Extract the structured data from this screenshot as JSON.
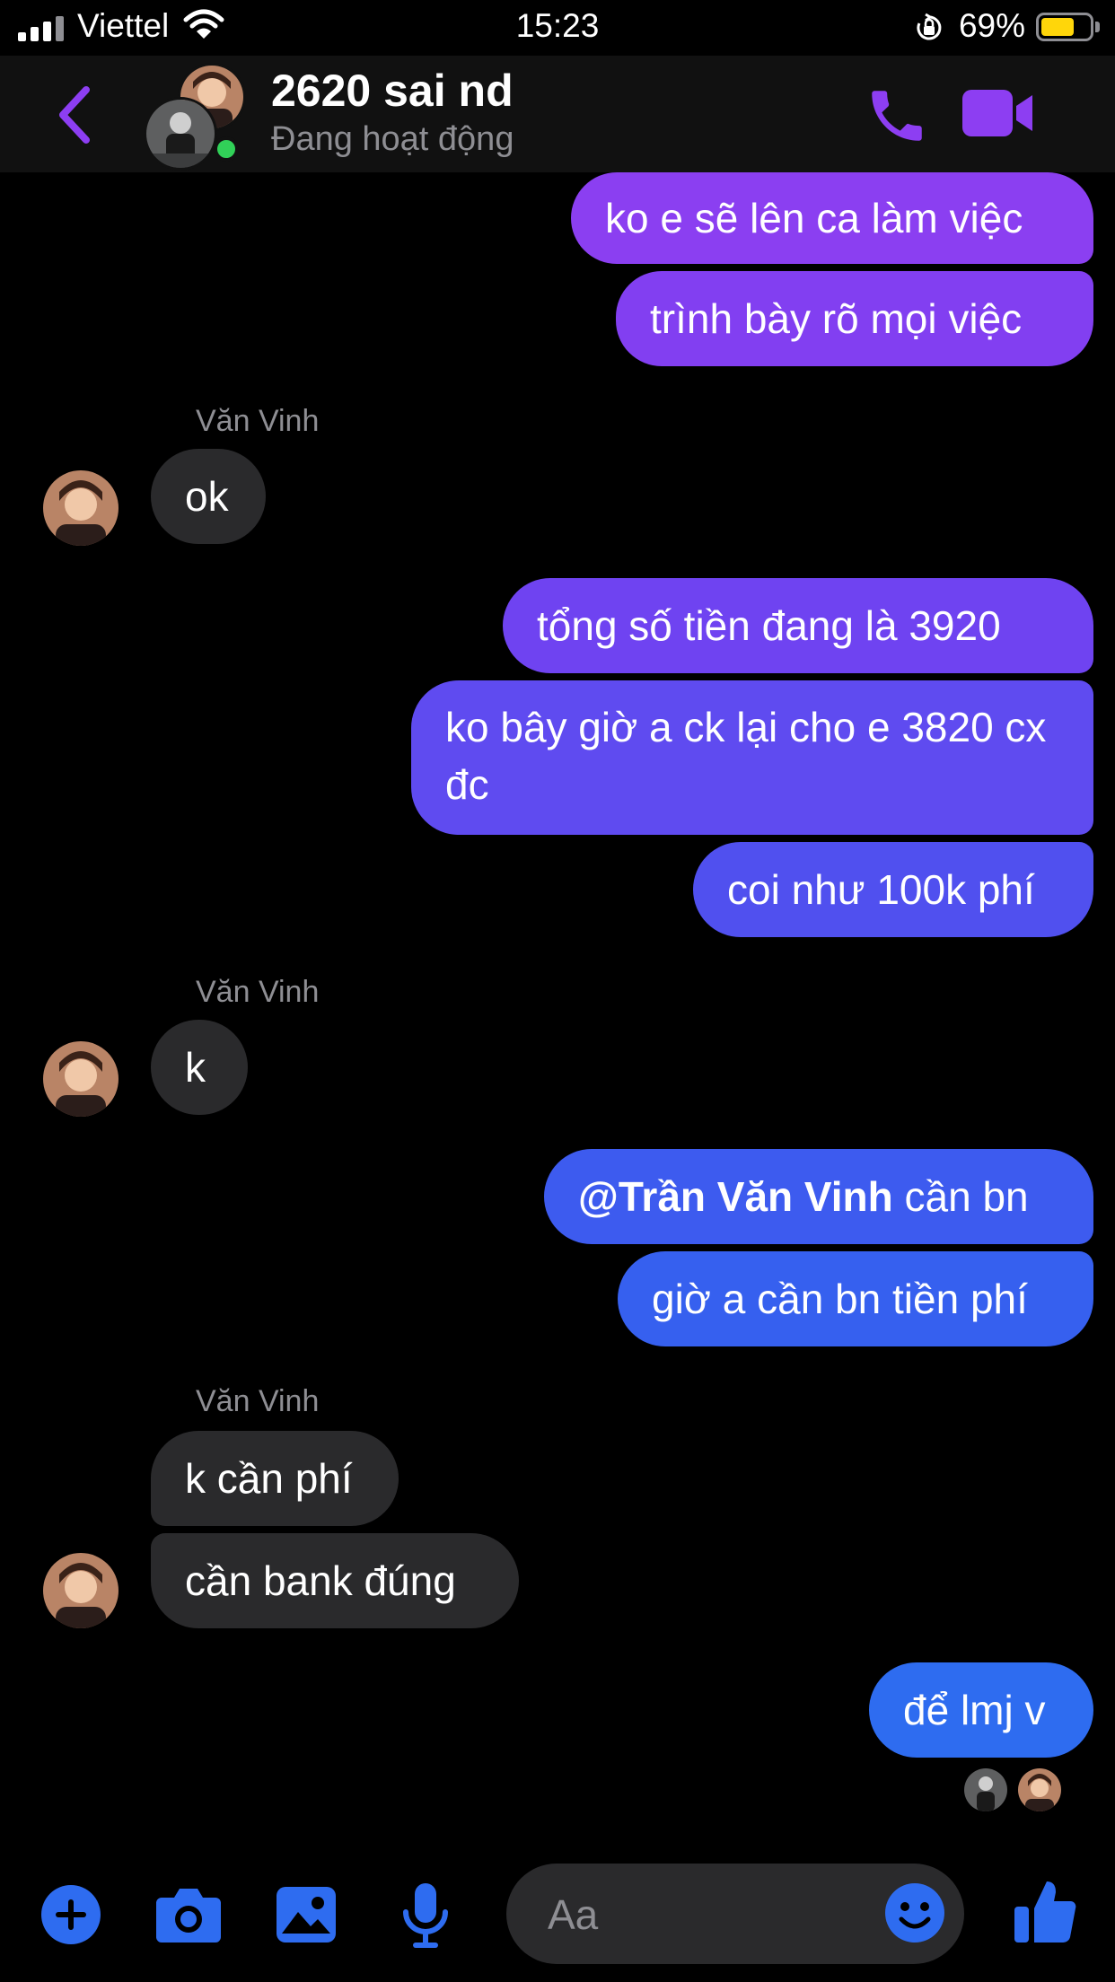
{
  "status_bar": {
    "carrier": "Viettel",
    "time": "15:23",
    "battery": "69%"
  },
  "header": {
    "contact_name": "2620 sai nd",
    "status": "Đang hoạt động"
  },
  "messages": {
    "m1": "ko e sẽ lên ca làm việc",
    "m2": "trình bày rõ mọi việc",
    "sender1": "Văn Vinh",
    "m3": "ok",
    "m4": "tổng số tiền đang là 3920",
    "m5": "ko bây giờ a ck lại cho e 3820 cx đc",
    "m6": "coi như 100k phí",
    "sender2": "Văn Vinh",
    "m7": "k",
    "m8_mention": "@Trần Văn Vinh",
    "m8_rest": " cần bn",
    "m9": "giờ a cần bn tiền phí",
    "sender3": "Văn Vinh",
    "m10": "k cần phí",
    "m11": "cần bank đúng",
    "m12": "để lmj v"
  },
  "composer": {
    "placeholder": "Aa",
    "value": ""
  },
  "colors": {
    "accent": "#8d3ef2",
    "bubble_top": "#8a3ff0",
    "bubble_bottom": "#2e6cf0",
    "incoming": "#2a2a2c",
    "online": "#31d158"
  },
  "icons": [
    "back-chevron-icon",
    "phone-icon",
    "video-camera-icon",
    "plus-icon",
    "camera-icon",
    "image-icon",
    "microphone-icon",
    "emoji-icon",
    "thumbs-up-icon"
  ]
}
